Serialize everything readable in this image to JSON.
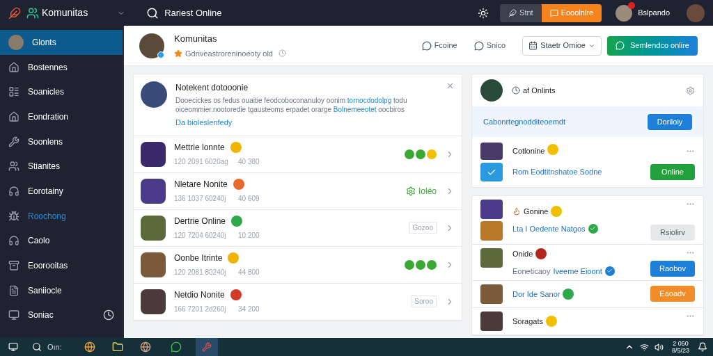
{
  "topbar": {
    "app_name": "Komunitas",
    "search": {
      "value": "Rariest Online"
    },
    "segments": [
      {
        "label": "Stnt",
        "selected": false
      },
      {
        "label": "Eooolnlre",
        "selected": true
      }
    ],
    "user": {
      "name": "Bslpando",
      "unread": true
    }
  },
  "sidebar": {
    "items": [
      {
        "label": "Glonts",
        "selected": true,
        "highlighted": false
      },
      {
        "label": "Bostennes",
        "selected": false,
        "highlighted": false
      },
      {
        "label": "Soanicles",
        "selected": false,
        "highlighted": false
      },
      {
        "label": "Eondration",
        "selected": false,
        "highlighted": false
      },
      {
        "label": "Soonlens",
        "selected": false,
        "highlighted": false
      },
      {
        "label": "Stianites",
        "selected": false,
        "highlighted": false
      },
      {
        "label": "Eorotainy",
        "selected": false,
        "highlighted": false
      },
      {
        "label": "Roochong",
        "selected": false,
        "highlighted": true
      },
      {
        "label": "Caolo",
        "selected": false,
        "highlighted": false
      },
      {
        "label": "Eoorooitas",
        "selected": false,
        "highlighted": false
      },
      {
        "label": "Saniiocle",
        "selected": false,
        "highlighted": false
      },
      {
        "label": "Soniac",
        "selected": false,
        "highlighted": false
      }
    ]
  },
  "header": {
    "title": "Komunitas",
    "subtitle": "Gdnveastroreninoeoty old",
    "online": true,
    "actions": [
      {
        "kind": "link",
        "label": "Fcoine"
      },
      {
        "kind": "link",
        "label": "Snico"
      },
      {
        "kind": "dropdown",
        "label": "Staetr Omioe"
      },
      {
        "kind": "primary",
        "label": "Semlendco onlire"
      }
    ]
  },
  "notice": {
    "title": "Notekent dotooonie",
    "body": [
      {
        "kind": "text",
        "text": "Dooecickes os fedus ouaitie feodcoboconanuloy oonim"
      },
      {
        "kind": "link",
        "text": "tornocdodolpg"
      },
      {
        "kind": "text",
        "text": "todu oiceommier.nootoredie tgausteoms erpadet orarge"
      },
      {
        "kind": "link",
        "text": "Bolnemeeotet"
      },
      {
        "kind": "text",
        "text": "oocbiros"
      }
    ],
    "link": "Da bioleslenfedy"
  },
  "list": [
    {
      "name": "Mettrie lonnte",
      "color": "#f0b400",
      "date": "120 2091 6020ag",
      "count": "40 380",
      "trailing": {
        "kind": "icons",
        "icons": [
          {
            "color": "#3aa933"
          },
          {
            "color": "#3aa933"
          },
          {
            "color": "#f0c000"
          }
        ]
      }
    },
    {
      "name": "Nletare Nonite",
      "color": "#e8692a",
      "date": "136 1037 60240j",
      "count": "40 609",
      "trailing": {
        "kind": "status",
        "label": "Ioléo"
      }
    },
    {
      "name": "Dertrie Online",
      "color": "#2ea84a",
      "date": "120 7204 60240j",
      "count": "10 200",
      "trailing": {
        "kind": "tag",
        "label": "Gozoo"
      }
    },
    {
      "name": "Oonbe Itrinte",
      "color": "#f0b400",
      "date": "120 2081 80240j",
      "count": "44 800",
      "trailing": {
        "kind": "icons",
        "icons": [
          {
            "color": "#3aa933"
          },
          {
            "color": "#3aa933"
          },
          {
            "color": "#3aa933"
          }
        ]
      }
    },
    {
      "name": "Netdio Nonite",
      "color": "#d23a2a",
      "date": "166 7201 2d260j",
      "count": "34 200",
      "trailing": {
        "kind": "tag",
        "label": "Soroo"
      }
    }
  ],
  "online_card": {
    "title": "af Onlints",
    "banner": {
      "text": "Cabonrtegnodditeoemdt",
      "button": "Doriloiy"
    },
    "item": {
      "name": "Cotlonine",
      "color": "#f0c000",
      "subtitle": "Rom Eodtitnshatoe Sodne",
      "button": "Online"
    }
  },
  "activity": [
    {
      "kind": "detail",
      "name": "Gonine",
      "color": "#f0c000",
      "subtitle": "Lta I Oedente Natgos",
      "check": {
        "color": "#2ea84a"
      },
      "button": {
        "kind": "neutral",
        "label": "Rsiolirv"
      }
    },
    {
      "kind": "detail",
      "name": "Onide",
      "color": "#b3261e",
      "subtitle": "Iveeme Eioont",
      "subtitle_prefix": "Eoneticaoy",
      "check": {
        "color": "#1e7fd8"
      },
      "button": {
        "kind": "primary",
        "label": "Raobov"
      }
    },
    {
      "kind": "link",
      "name": "Dor Ide Sanor",
      "color": "#2ea84a",
      "button": {
        "kind": "warning",
        "label": "Eaoadv"
      }
    },
    {
      "kind": "plain",
      "name": "Soragats",
      "color": "#f0c000"
    }
  ],
  "taskbar": {
    "search": "Oın:",
    "time": "2 050",
    "date": "8/5/23"
  }
}
